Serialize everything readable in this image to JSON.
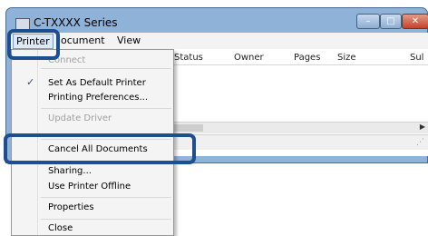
{
  "window": {
    "title": "C-TXXXX Series"
  },
  "menubar": {
    "printer": "Printer",
    "document": "ocument",
    "view": "View"
  },
  "columns": [
    "Status",
    "Owner",
    "Pages",
    "Size",
    "Sul"
  ],
  "menu": {
    "connect": "Connect",
    "set_default": "Set As Default Printer",
    "set_default_checked": true,
    "printing_prefs": "Printing Preferences...",
    "update_driver": "Update Driver",
    "cancel_all": "Cancel All Documents",
    "sharing": "Sharing...",
    "use_offline": "Use Printer Offline",
    "properties": "Properties",
    "close": "Close"
  },
  "colors": {
    "highlight": "#1d4e8f",
    "titlebar": "#8fb2d8",
    "close_button": "#c4432a"
  }
}
